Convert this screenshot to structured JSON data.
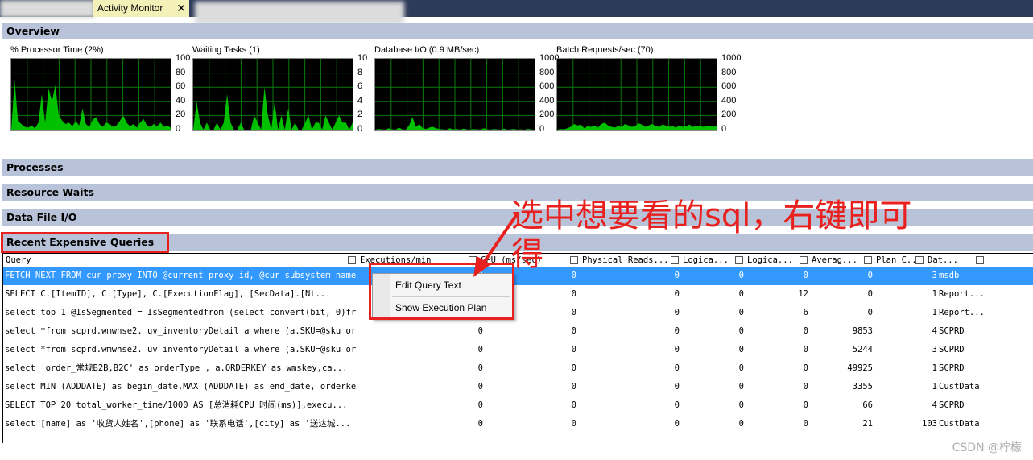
{
  "window": {
    "tab_title": "Activity Monitor",
    "close_glyph": "✕",
    "colors": {
      "titlebar": "#2d3a5a",
      "tab": "#f4f1b8",
      "section": "#b8c3d9",
      "selection": "#3399ff",
      "annotation": "#e8201e",
      "graph_bg": "#000000",
      "graph_line": "#00c000"
    }
  },
  "overview": {
    "label": "Overview"
  },
  "gauges": [
    {
      "title": "% Processor Time (2%)",
      "ticks": [
        "100",
        "80",
        "60",
        "40",
        "20",
        "0"
      ],
      "max": 100,
      "samples": [
        0,
        70,
        12,
        8,
        4,
        3,
        6,
        2,
        10,
        50,
        10,
        58,
        40,
        63,
        20,
        13,
        8,
        10,
        5,
        12,
        6,
        30,
        8,
        4,
        14,
        18,
        8,
        4,
        10,
        8,
        4,
        6,
        12,
        20,
        10,
        5,
        8,
        3,
        10,
        15,
        6,
        4,
        8,
        5,
        10,
        4,
        6,
        3
      ]
    },
    {
      "title": "Waiting Tasks (1)",
      "ticks": [
        "10",
        "8",
        "6",
        "4",
        "2",
        "0"
      ],
      "max": 10,
      "samples": [
        0,
        4,
        1,
        0,
        1,
        0,
        0,
        1,
        0,
        1,
        5,
        1,
        0,
        0,
        1,
        0,
        0,
        0,
        2,
        1,
        0,
        6,
        2,
        0,
        4,
        0,
        2,
        0,
        3,
        0,
        1,
        0,
        0,
        1,
        2,
        0,
        1,
        1,
        0,
        2,
        1,
        0,
        1,
        2,
        1,
        1,
        0,
        1
      ]
    },
    {
      "title": "Database I/O (0.9 MB/sec)",
      "ticks": [
        "1000",
        "800",
        "600",
        "400",
        "200",
        "0"
      ],
      "max": 1000,
      "samples": [
        0,
        10,
        5,
        0,
        20,
        5,
        0,
        30,
        5,
        0,
        60,
        180,
        40,
        80,
        20,
        10,
        30,
        40,
        20,
        10,
        5,
        0,
        20,
        5,
        10,
        0,
        15,
        5,
        0,
        10,
        5,
        0,
        20,
        5,
        0,
        10,
        5,
        0,
        15,
        0,
        5,
        10,
        0,
        5,
        0,
        10,
        5,
        0
      ]
    },
    {
      "title": "Batch Requests/sec (70)",
      "ticks": [
        "1000",
        "800",
        "600",
        "400",
        "200",
        "0"
      ],
      "max": 1000,
      "samples": [
        0,
        10,
        5,
        20,
        40,
        80,
        60,
        70,
        20,
        50,
        40,
        60,
        30,
        80,
        100,
        60,
        40,
        30,
        50,
        40,
        80,
        60,
        40,
        50,
        90,
        70,
        40,
        60,
        80,
        50,
        40,
        70,
        60,
        40,
        50,
        30,
        60,
        40,
        50,
        70,
        40,
        50,
        60,
        40,
        50,
        60,
        40,
        50
      ]
    }
  ],
  "sections": {
    "processes": "Processes",
    "resource_waits": "Resource Waits",
    "data_file_io": "Data File I/O",
    "recent_queries": "Recent Expensive Queries"
  },
  "grid": {
    "columns": [
      "Query",
      "Executions/min",
      "CPU (ms/sec)",
      "Physical Reads...",
      "Logica...",
      "Logica...",
      "Averag...",
      "Plan C...",
      "Dat..."
    ],
    "rows": [
      [
        "FETCH NEXT FROM cur_proxy INTO @current_proxy_id, @cur_subsystem_name...",
        "0",
        "0",
        "0",
        "0",
        "0",
        "0",
        "3",
        "msdb"
      ],
      [
        "SELECT   C.[ItemID],   C.[Type],   C.[ExecutionFlag],   [SecData].[Nt...",
        "",
        "0",
        "0",
        "0",
        "12",
        "0",
        "1",
        "Report..."
      ],
      [
        "select top 1 @IsSegmented = IsSegmentedfrom (select convert(bit, 0)fr...",
        "",
        "0",
        "0",
        "0",
        "6",
        "0",
        "1",
        "Report..."
      ],
      [
        "select *from scprd.wmwhse2. uv_inventoryDetail a where (a.SKU=@sku or...",
        "0",
        "0",
        "0",
        "0",
        "0",
        "9853",
        "4",
        "SCPRD"
      ],
      [
        "select *from scprd.wmwhse2. uv_inventoryDetail a where (a.SKU=@sku or...",
        "0",
        "0",
        "0",
        "0",
        "0",
        "5244",
        "3",
        "SCPRD"
      ],
      [
        "select   'order_常规B2B,B2C' as orderType , a.ORDERKEY  as wmskey,ca...",
        "0",
        "0",
        "0",
        "0",
        "0",
        "49925",
        "1",
        "SCPRD"
      ],
      [
        "select MIN (ADDDATE) as begin_date,MAX (ADDDATE) as end_date, orderke...",
        "0",
        "0",
        "0",
        "0",
        "0",
        "3355",
        "1",
        "CustData"
      ],
      [
        "SELECT TOP 20    total_worker_time/1000 AS [总消耗CPU 时间(ms)],execu...",
        "0",
        "0",
        "0",
        "0",
        "0",
        "66",
        "4",
        "SCPRD"
      ],
      [
        "select [name] as '收货人姓名',[phone] as '联系电话',[city] as '送达城...",
        "0",
        "0",
        "0",
        "0",
        "0",
        "21",
        "103",
        "CustData"
      ]
    ]
  },
  "context_menu": {
    "items": [
      "Edit Query Text",
      "Show Execution Plan"
    ]
  },
  "annotation": {
    "line1": "选中想要看的sql，右键即可",
    "line2": "得"
  },
  "watermark": "CSDN @柠檬"
}
